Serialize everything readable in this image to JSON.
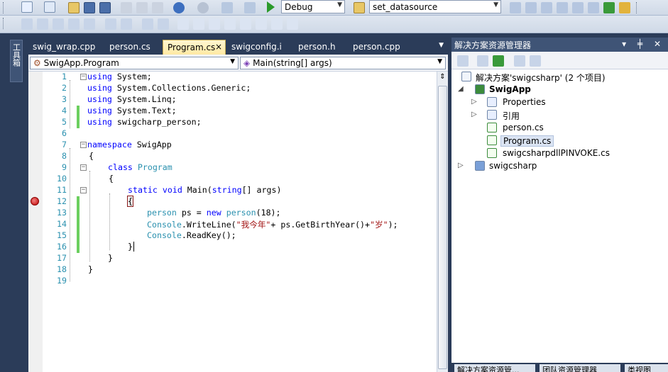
{
  "toolbar": {
    "config": "Debug",
    "startup_item": "set_datasource"
  },
  "left_rail": {
    "toolbox_label": "工具箱"
  },
  "tabs": [
    {
      "label": "swig_wrap.cpp"
    },
    {
      "label": "person.cs"
    },
    {
      "label": "Program.cs",
      "close": "×"
    },
    {
      "label": "swigconfig.i"
    },
    {
      "label": "person.h"
    },
    {
      "label": "person.cpp"
    }
  ],
  "navbar": {
    "class_value": "SwigApp.Program",
    "member_value": "Main(string[] args)"
  },
  "code_lines": [
    {
      "n": "1"
    },
    {
      "n": "2"
    },
    {
      "n": "3"
    },
    {
      "n": "4"
    },
    {
      "n": "5"
    },
    {
      "n": "6"
    },
    {
      "n": "7"
    },
    {
      "n": "8"
    },
    {
      "n": "9"
    },
    {
      "n": "10"
    },
    {
      "n": "11"
    },
    {
      "n": "12"
    },
    {
      "n": "13"
    },
    {
      "n": "14"
    },
    {
      "n": "15"
    },
    {
      "n": "16"
    },
    {
      "n": "17"
    },
    {
      "n": "18"
    },
    {
      "n": "19"
    }
  ],
  "code": {
    "l1a": "using",
    "l1b": " System;",
    "l2a": "using",
    "l2b": " System.Collections.Generic;",
    "l3a": "using",
    "l3b": " System.Linq;",
    "l4a": "using",
    "l4b": " System.Text;",
    "l5a": "using",
    "l5b": " swigcharp_person;",
    "l7a": "namespace",
    "l7b": " SwigApp",
    "l8": "{",
    "l9a": "class",
    "l9b": "Program",
    "l10": "{",
    "l11a": "static",
    "l11b": "void",
    "l11c": " Main(",
    "l11d": "string",
    "l11e": "[] args)",
    "l12": "{",
    "l13a": "person",
    "l13b": " ps = ",
    "l13c": "new",
    "l13d": "person",
    "l13e": "(18);",
    "l14a": "Console",
    "l14b": ".WriteLine(",
    "l14c": "\"我今年\"",
    "l14d": "+ ps.GetBirthYear()+",
    "l14e": "\"岁\"",
    "l14f": ");",
    "l15a": "Console",
    "l15b": ".ReadKey();",
    "l16": "}",
    "l17": "}",
    "l18": "}"
  },
  "solution": {
    "title": "解决方案资源管理器",
    "title_ctrls": "▾ ╪ ✕",
    "root": "解决方案'swigcsharp' (2 个项目)",
    "project": "SwigApp",
    "items": [
      "Properties",
      "引用",
      "person.cs",
      "Program.cs",
      "swigcsharpdllPINVOKE.cs"
    ],
    "project2": "swigcsharp"
  },
  "bottom_tabs": [
    "解决方案资源管...",
    "团队资源管理器",
    "类视图"
  ],
  "colors": {
    "keyword": "#0000ff",
    "type": "#2b91af",
    "string": "#a31515",
    "change_bar": "#6ccf5f"
  }
}
